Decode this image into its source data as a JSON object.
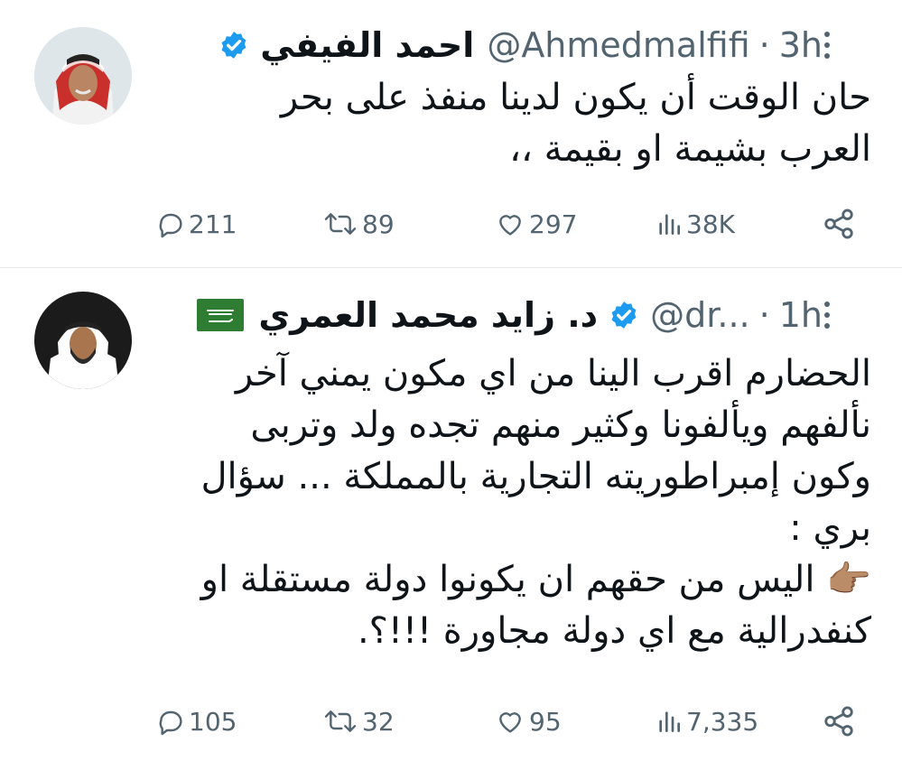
{
  "tweets": [
    {
      "name": "احمد الفيفي",
      "handle": "@Ahmedmalfifi",
      "time": "3h",
      "body": "حان الوقت أن يكون لدينا منفذ على بحر\nالعرب بشيمة او بقيمة ،،",
      "replies": "211",
      "retweets": "89",
      "likes": "297",
      "views": "38K"
    },
    {
      "name": "د. زايد محمد العمري",
      "handle": "@dr...",
      "time": "1h",
      "body": "الحضارم اقرب الينا من اي مكون يمني آخر\nنألفهم ويألفونا وكثير منهم تجده ولد وتربى\nوكون إمبراطوريته التجارية بالمملكة ... سؤال\nبري :\n👉🏽 اليس من حقهم ان يكونوا دولة مستقلة او\nكنفدرالية مع اي دولة مجاورة !!!؟.",
      "replies": "105",
      "retweets": "32",
      "likes": "95",
      "views": "7,335"
    }
  ],
  "separator": "·",
  "icons": {
    "verified": "verified-badge-icon",
    "flag": "saudi-flag-icon",
    "more": "more-icon",
    "reply": "reply-icon",
    "retweet": "retweet-icon",
    "like": "like-icon",
    "views": "views-icon",
    "share": "share-icon"
  },
  "colors": {
    "verified": "#1d9bf0",
    "text": "#0f1419",
    "secondary": "#536471",
    "flag": "#2e7d32"
  }
}
